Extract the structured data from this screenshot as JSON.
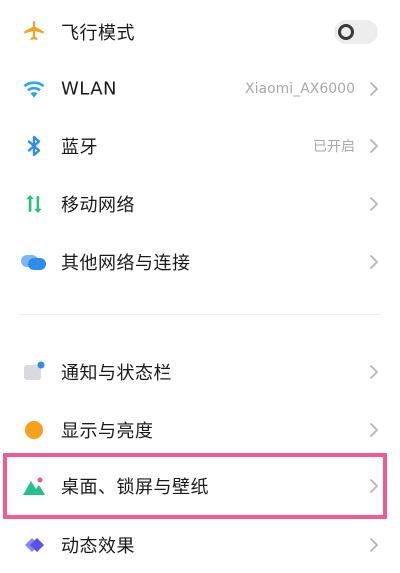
{
  "settings": {
    "items": [
      {
        "label": "飞行模式",
        "value": "",
        "control": "toggle",
        "toggle_on": false,
        "icon": "airplane-icon"
      },
      {
        "label": "WLAN",
        "value": "Xiaomi_AX6000",
        "control": "chevron",
        "icon": "wifi-icon"
      },
      {
        "label": "蓝牙",
        "value": "已开启",
        "control": "chevron",
        "icon": "bluetooth-icon"
      },
      {
        "label": "移动网络",
        "value": "",
        "control": "chevron",
        "icon": "mobile-data-icon"
      },
      {
        "label": "其他网络与连接",
        "value": "",
        "control": "chevron",
        "icon": "cloud-network-icon"
      },
      {
        "label": "通知与状态栏",
        "value": "",
        "control": "chevron",
        "icon": "notification-icon"
      },
      {
        "label": "显示与亮度",
        "value": "",
        "control": "chevron",
        "icon": "brightness-icon"
      },
      {
        "label": "桌面、锁屏与壁纸",
        "value": "",
        "control": "chevron",
        "icon": "wallpaper-icon",
        "highlighted": true
      },
      {
        "label": "动态效果",
        "value": "",
        "control": "chevron",
        "icon": "animation-icon"
      }
    ]
  },
  "colors": {
    "highlight_border": "#f25a96",
    "label_text": "#1a1a1a",
    "secondary_text": "#a8a8a8",
    "airplane_icon": "#f5a31a",
    "wifi_icon": "#2aa6ef",
    "bluetooth_icon": "#2d8cf0",
    "mobile_data_icon": "#27c277",
    "cloud_icon": "#2d8cf0",
    "brightness_icon": "#f7a11a",
    "wallpaper_icon": "#1fc18c",
    "animation_icon": "#6a62f0"
  }
}
